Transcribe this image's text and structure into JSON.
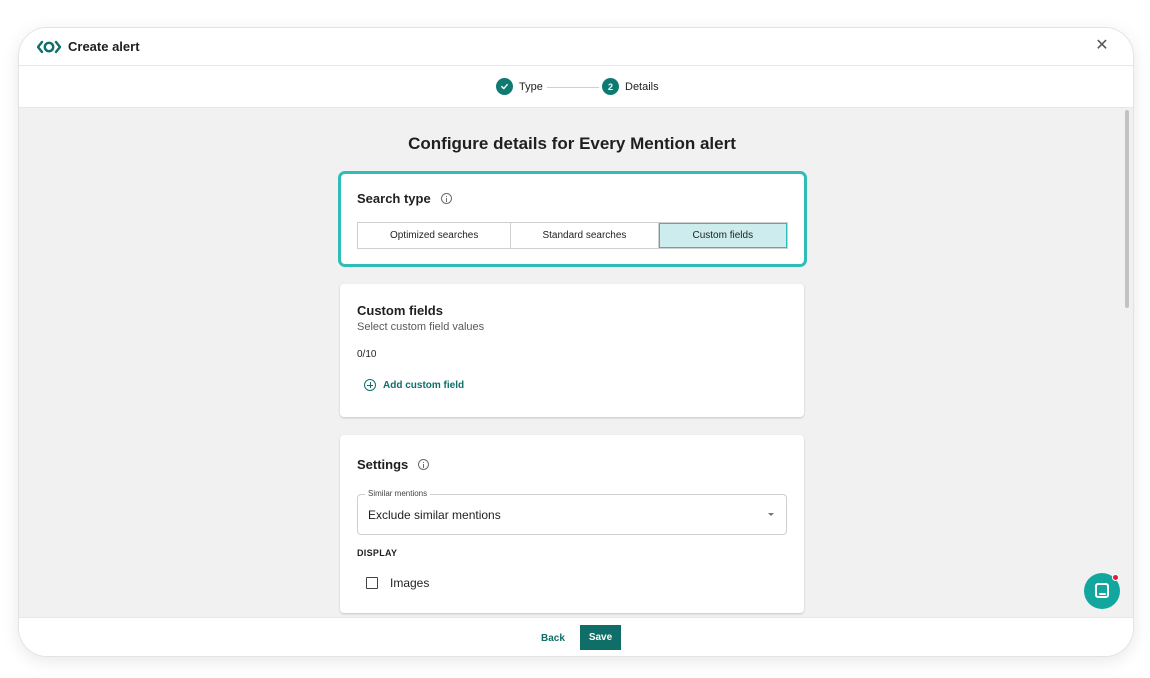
{
  "window": {
    "title": "Create alert",
    "close_glyph": "✕"
  },
  "stepper": {
    "steps": [
      {
        "label": "Type",
        "state": "complete",
        "icon": "check-icon"
      },
      {
        "label": "Details",
        "state": "active",
        "number": "2"
      }
    ]
  },
  "main": {
    "page_title": "Configure details for Every Mention alert",
    "search_type": {
      "heading": "Search type",
      "options": [
        "Optimized searches",
        "Standard searches",
        "Custom fields"
      ],
      "selected": "Custom fields"
    },
    "custom_fields": {
      "heading": "Custom fields",
      "subtitle": "Select custom field values",
      "count": "0/10",
      "add_label": "Add custom field"
    },
    "settings": {
      "heading": "Settings",
      "similar_mentions_label": "Similar mentions",
      "similar_mentions_value": "Exclude similar mentions",
      "display_label": "DISPLAY",
      "images_label": "Images"
    }
  },
  "footer": {
    "back_label": "Back",
    "save_label": "Save"
  },
  "colors": {
    "brand": "#0f6e68",
    "highlight": "#2ebdb7",
    "chat": "#12a79e",
    "notification": "#e21b3c"
  }
}
